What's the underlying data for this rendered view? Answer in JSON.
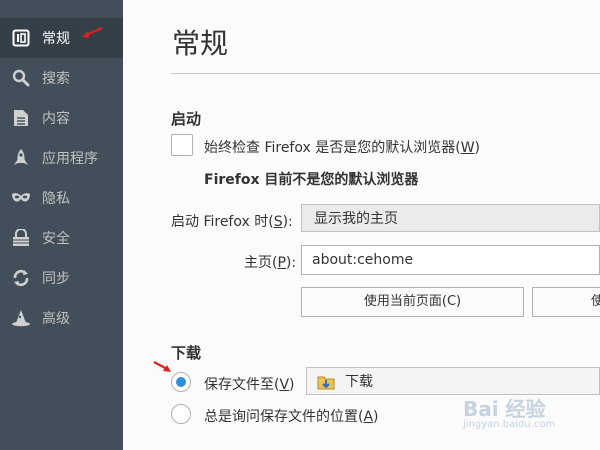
{
  "sidebar": {
    "items": [
      {
        "label": "常规",
        "icon": "general-icon",
        "active": true
      },
      {
        "label": "搜索",
        "icon": "search-icon",
        "active": false
      },
      {
        "label": "内容",
        "icon": "content-icon",
        "active": false
      },
      {
        "label": "应用程序",
        "icon": "rocket-icon",
        "active": false
      },
      {
        "label": "隐私",
        "icon": "mask-icon",
        "active": false
      },
      {
        "label": "安全",
        "icon": "lock-icon",
        "active": false
      },
      {
        "label": "同步",
        "icon": "sync-icon",
        "active": false
      },
      {
        "label": "高级",
        "icon": "wizard-hat-icon",
        "active": false
      }
    ]
  },
  "main": {
    "title": "常规",
    "startup": {
      "heading": "启动",
      "default_check_label": "始终检查 Firefox 是否是您的默认浏览器(",
      "default_check_key": "W",
      "default_check_tail": ")",
      "default_check_checked": false,
      "not_default_note": "Firefox 目前不是您的默认浏览器",
      "when_starts_label": "启动 Firefox 时(",
      "when_starts_key": "S",
      "when_starts_tail": "):",
      "when_starts_value": "显示我的主页",
      "homepage_label": "主页(",
      "homepage_key": "P",
      "homepage_tail": "):",
      "homepage_value": "about:cehome",
      "use_current_label": "使用当前页面(C)",
      "use_bookmark_label_partial": "使"
    },
    "downloads": {
      "heading": "下载",
      "save_to_label": "保存文件至(",
      "save_to_key": "V",
      "save_to_tail": ")",
      "save_to_selected": true,
      "folder_name": "下载",
      "always_ask_label": "总是询问保存文件的位置(",
      "always_ask_key": "A",
      "always_ask_tail": ")",
      "always_ask_selected": false
    }
  },
  "watermark": {
    "title": "Bai 经验",
    "url": "jingyan.baidu.com"
  },
  "colors": {
    "sidebar_bg": "#424f5a",
    "sidebar_active": "#343f48",
    "accent": "#2b8fd6",
    "annotation_arrow": "#e02020"
  }
}
